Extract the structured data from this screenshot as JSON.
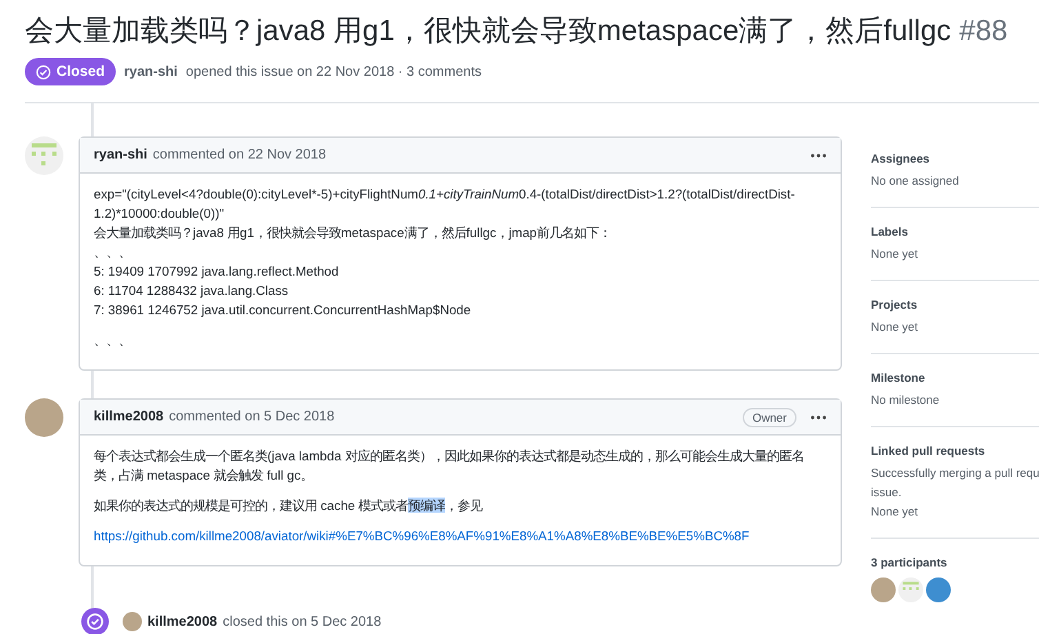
{
  "issue": {
    "title": "会大量加载类吗？java8 用g1，很快就会导致metaspace满了，然后fullgc",
    "number": "#88",
    "state": "Closed",
    "author": "ryan-shi",
    "meta": "opened this issue on 22 Nov 2018 · 3 comments"
  },
  "comments": [
    {
      "author": "ryan-shi",
      "action": "commented on 22 Nov 2018",
      "avatar": {
        "kind": "identicon"
      },
      "paragraphs": [
        [
          [
            {
              "kind": "plain",
              "text": "exp=\"(cityLevel<4?double(0):cityLevel*-5)+cityFlightNum"
            },
            {
              "kind": "italic",
              "text": "0.1+cityTrainNum"
            },
            {
              "kind": "plain",
              "text": "0.4-(totalDist/directDist>1.2?(totalDist/directDist-"
            }
          ],
          [
            {
              "kind": "plain",
              "text": "1.2)*10000:double(0))\""
            }
          ],
          [
            {
              "kind": "plain",
              "text": "会大量加载类吗？java8 用g1，很快就会导致metaspace满了，然后fullgc，jmap前几名如下："
            }
          ],
          [
            {
              "kind": "plain",
              "text": "、、、"
            }
          ],
          [
            {
              "kind": "plain",
              "text": "5: 19409 1707992 java.lang.reflect.Method"
            }
          ],
          [
            {
              "kind": "plain",
              "text": "6: 11704 1288432 java.lang.Class"
            }
          ],
          [
            {
              "kind": "plain",
              "text": "7: 38961 1246752 java.util.concurrent.ConcurrentHashMap$Node"
            }
          ]
        ],
        [
          [
            {
              "kind": "plain",
              "text": "、、、"
            }
          ]
        ]
      ]
    },
    {
      "author": "killme2008",
      "action": "commented on 5 Dec 2018",
      "avatar": {
        "kind": "photo"
      },
      "badge": "Owner",
      "paragraphs": [
        [
          [
            {
              "kind": "plain",
              "text": "每个表达式都会生成一个匿名类(java lambda 对应的匿名类），因此如果你的表达式都是动态生成的，那么可能会生成大量的匿名"
            }
          ],
          [
            {
              "kind": "plain",
              "text": "类，占满 metaspace 就会触发 full gc。"
            }
          ]
        ],
        [
          [
            {
              "kind": "plain",
              "text": "如果你的表达式的规模是可控的，建议用 cache 模式或者"
            },
            {
              "kind": "highlight",
              "text": "预编译"
            },
            {
              "kind": "plain",
              "text": "，参见"
            }
          ]
        ],
        [
          [
            {
              "kind": "link",
              "text": "https://github.com/killme2008/aviator/wiki#%E7%BC%96%E8%AF%91%E8%A1%A8%E8%BE%BE%E5%BC%8F"
            }
          ]
        ]
      ]
    }
  ],
  "event": {
    "author": "killme2008",
    "action": "closed this on 5 Dec 2018"
  },
  "sidebar": {
    "sections": [
      {
        "heading": "Assignees",
        "texts": [
          "No one assigned"
        ]
      },
      {
        "heading": "Labels",
        "texts": [
          "None yet"
        ]
      },
      {
        "heading": "Projects",
        "texts": [
          "None yet"
        ]
      },
      {
        "heading": "Milestone",
        "texts": [
          "No milestone"
        ]
      },
      {
        "heading": "Linked pull requests",
        "texts": [
          "Successfully merging a pull requ",
          "issue.",
          "None yet"
        ]
      }
    ],
    "participants": {
      "heading": "3 participants",
      "avatars": [
        {
          "kind": "photo"
        },
        {
          "kind": "identicon"
        },
        {
          "kind": "cartoon"
        }
      ]
    }
  }
}
